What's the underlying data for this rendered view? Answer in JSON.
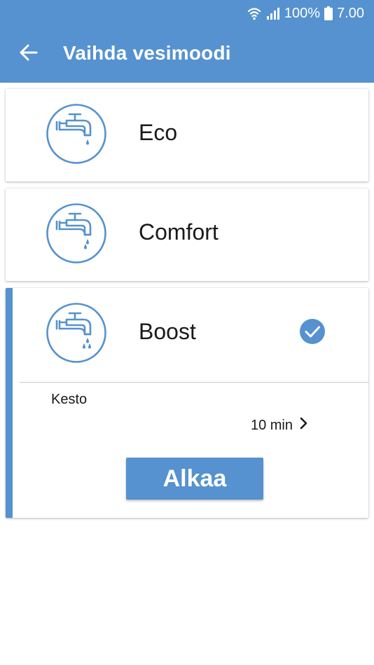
{
  "status_bar": {
    "battery_percent": "100%",
    "time": "7.00",
    "icons": [
      "wifi-icon",
      "signal-icon",
      "battery-icon"
    ]
  },
  "header": {
    "title": "Vaihda vesimoodi",
    "back_icon": "arrow-left-icon"
  },
  "modes": [
    {
      "label": "Eco",
      "icon": "faucet-icon",
      "drops": 1,
      "selected": false
    },
    {
      "label": "Comfort",
      "icon": "faucet-icon",
      "drops": 2,
      "selected": false
    },
    {
      "label": "Boost",
      "icon": "faucet-icon",
      "drops": 3,
      "selected": true
    }
  ],
  "boost_panel": {
    "duration_label": "Kesto",
    "duration_value": "10 min",
    "start_label": "Alkaa"
  },
  "colors": {
    "accent": "#5592cf",
    "text": "#1a1a1a",
    "background": "#ffffff"
  }
}
